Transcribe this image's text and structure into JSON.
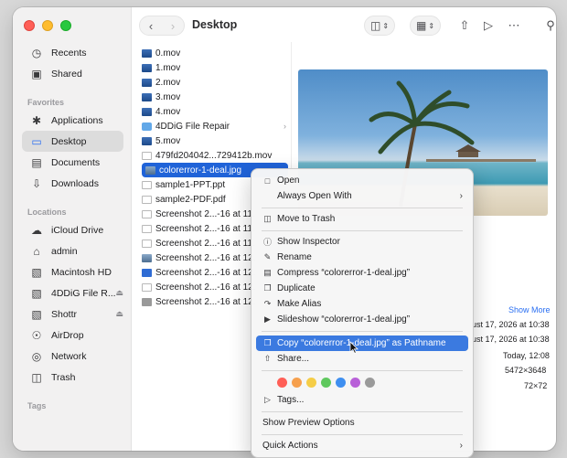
{
  "window": {
    "title": "Desktop"
  },
  "sidebar": {
    "top_items": [
      {
        "label": "Recents",
        "icon": "clock-icon"
      },
      {
        "label": "Shared",
        "icon": "shared-folder-icon"
      }
    ],
    "favorites_header": "Favorites",
    "favorites": [
      {
        "label": "Applications",
        "icon": "applications-icon"
      },
      {
        "label": "Desktop",
        "icon": "desktop-icon",
        "selected": true
      },
      {
        "label": "Documents",
        "icon": "document-icon"
      },
      {
        "label": "Downloads",
        "icon": "download-icon"
      }
    ],
    "locations_header": "Locations",
    "locations": [
      {
        "label": "iCloud Drive",
        "icon": "cloud-icon"
      },
      {
        "label": "admin",
        "icon": "home-icon"
      },
      {
        "label": "Macintosh HD",
        "icon": "disk-icon"
      },
      {
        "label": "4DDiG File R...",
        "icon": "disk-icon",
        "eject": true
      },
      {
        "label": "Shottr",
        "icon": "disk-icon",
        "eject": true
      },
      {
        "label": "AirDrop",
        "icon": "airdrop-icon"
      },
      {
        "label": "Network",
        "icon": "globe-icon"
      },
      {
        "label": "Trash",
        "icon": "trash-icon"
      }
    ],
    "tags_header": "Tags"
  },
  "files": [
    {
      "name": "0.mov",
      "kind": "mov"
    },
    {
      "name": "1.mov",
      "kind": "mov"
    },
    {
      "name": "2.mov",
      "kind": "mov"
    },
    {
      "name": "3.mov",
      "kind": "mov"
    },
    {
      "name": "4.mov",
      "kind": "mov"
    },
    {
      "name": "4DDiG File Repair",
      "kind": "folder",
      "chevron": true
    },
    {
      "name": "5.mov",
      "kind": "mov"
    },
    {
      "name": "479fd204042...729412b.mov",
      "kind": "doc"
    },
    {
      "name": "colorerror-1-deal.jpg",
      "kind": "img",
      "selected": true
    },
    {
      "name": "sample1-PPT.ppt",
      "kind": "doc"
    },
    {
      "name": "sample2-PDF.pdf",
      "kind": "doc"
    },
    {
      "name": "Screenshot 2...-16 at 11.",
      "kind": "doc"
    },
    {
      "name": "Screenshot 2...-16 at 11.",
      "kind": "doc"
    },
    {
      "name": "Screenshot 2...-16 at 11.",
      "kind": "doc"
    },
    {
      "name": "Screenshot 2...-16 at 12.",
      "kind": "img"
    },
    {
      "name": "Screenshot 2...-16 at 12.",
      "kind": "blue"
    },
    {
      "name": "Screenshot 2...-16 at 12.",
      "kind": "doc"
    },
    {
      "name": "Screenshot 2...-16 at 12.",
      "kind": "gray"
    }
  ],
  "info": {
    "show_more": "Show More",
    "rows": [
      "ust 17, 2026 at 10:38",
      "ust 17, 2026 at 10:38",
      "Today, 12:08",
      "5472×3648",
      "72×72"
    ]
  },
  "menu": {
    "open": "Open",
    "always_open_with": "Always Open With",
    "move_to_trash": "Move to Trash",
    "show_inspector": "Show Inspector",
    "rename": "Rename",
    "compress": "Compress “colorerror-1-deal.jpg”",
    "duplicate": "Duplicate",
    "make_alias": "Make Alias",
    "slideshow": "Slideshow “colorerror-1-deal.jpg”",
    "copy_pathname": "Copy “colorerror-1-deal.jpg” as Pathname",
    "share": "Share...",
    "tags": "Tags...",
    "show_preview_options": "Show Preview Options",
    "quick_actions": "Quick Actions",
    "tag_colors": [
      "#ff5f57",
      "#f6a04d",
      "#f5cd47",
      "#5fc85e",
      "#3f8ff0",
      "#b860d8",
      "#9a9a9a"
    ]
  }
}
